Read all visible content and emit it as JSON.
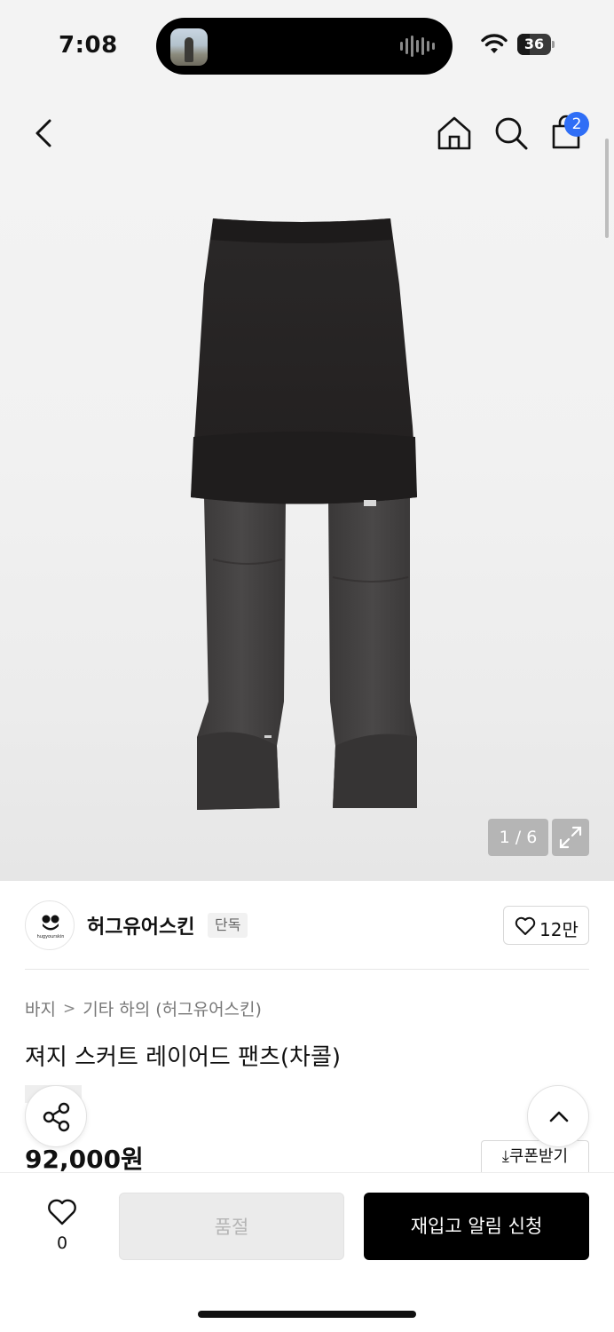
{
  "status_bar": {
    "time": "7:08",
    "battery_level": "36",
    "icons": [
      "wifi-icon",
      "battery-icon",
      "audio-wave-icon"
    ]
  },
  "nav": {
    "icons": [
      "back-icon",
      "home-icon",
      "search-icon",
      "shopping-bag-icon"
    ],
    "cart_count": "2"
  },
  "gallery": {
    "counter": "1 / 6",
    "icons": [
      "expand-icon"
    ]
  },
  "brand": {
    "logo_text": "hugyourskin",
    "name": "허그유어스킨",
    "tag": "단독",
    "like_count": "12만"
  },
  "product": {
    "breadcrumb": [
      "바지",
      "기타 하의 (허그유어스킨)"
    ],
    "title": "져지 스커트 레이어드 팬츠(차콜)",
    "price": "92,000원",
    "coupon_label": "쿠폰받기"
  },
  "actions": {
    "wish_count": "0",
    "soldout_label": "품절",
    "restock_label": "재입고 알림 신청"
  },
  "colors": {
    "accent_badge": "#2f6ef6",
    "primary_button": "#000000",
    "disabled_button": "#ebebeb"
  }
}
